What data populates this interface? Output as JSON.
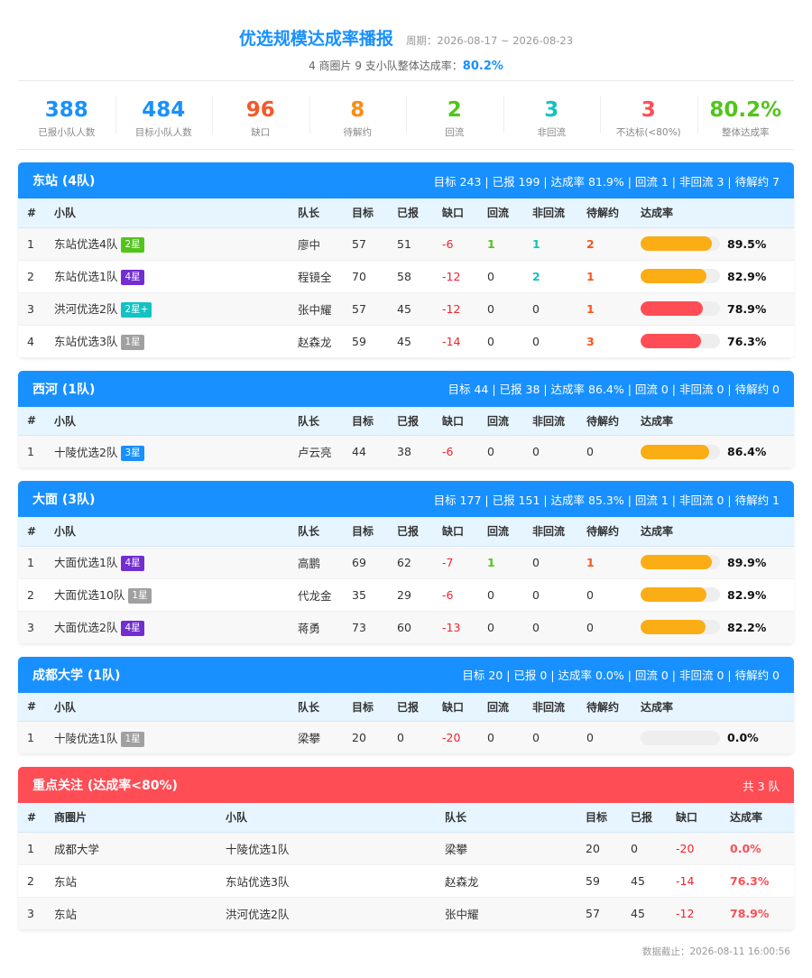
{
  "header": {
    "title": "优选规模达成率播报",
    "period": "周期：2026-08-17 ~ 2026-08-23",
    "subtitle_prefix": "4 商圈片 9 支小队整体达成率：",
    "overall_rate": "80.2%"
  },
  "stats": [
    {
      "value": "388",
      "label": "已报小队人数",
      "color": "#1890ff"
    },
    {
      "value": "484",
      "label": "目标小队人数",
      "color": "#1890ff"
    },
    {
      "value": "96",
      "label": "缺口",
      "color": "#f5582c"
    },
    {
      "value": "8",
      "label": "待解约",
      "color": "#fa8c16"
    },
    {
      "value": "2",
      "label": "回流",
      "color": "#52c41a"
    },
    {
      "value": "3",
      "label": "非回流",
      "color": "#13c2c2"
    },
    {
      "value": "3",
      "label": "不达标(<80%)",
      "color": "#ff4d55"
    },
    {
      "value": "80.2%",
      "label": "整体达成率",
      "color": "#52c41a"
    }
  ],
  "columns": [
    "#",
    "小队",
    "队长",
    "目标",
    "已报",
    "缺口",
    "回流",
    "非回流",
    "待解约",
    "达成率"
  ],
  "colors": {
    "blue": "#1890ff",
    "red": "#ff4d55",
    "bar_orange": "#faad14",
    "bar_red": "#ff4d55"
  },
  "sections": [
    {
      "name": "东站 (4队)",
      "summary": "目标 243 | 已报 199 | 达成率 81.9% | 回流 1 | 非回流 3 | 待解约 7",
      "rows": [
        {
          "idx": "1",
          "team": "东站优选4队",
          "star": "2星",
          "star_color": "#52c41a",
          "leader": "廖中",
          "target": "57",
          "reported": "51",
          "gap": "-6",
          "back": "1",
          "nonback": "1",
          "pending": "2",
          "rate": "89.5%",
          "rate_value": 89.5
        },
        {
          "idx": "2",
          "team": "东站优选1队",
          "star": "4星",
          "star_color": "#722ed1",
          "leader": "程镜全",
          "target": "70",
          "reported": "58",
          "gap": "-12",
          "back": "0",
          "nonback": "2",
          "pending": "1",
          "rate": "82.9%",
          "rate_value": 82.9
        },
        {
          "idx": "3",
          "team": "洪河优选2队",
          "star": "2星+",
          "star_color": "#13c2c2",
          "leader": "张中耀",
          "target": "57",
          "reported": "45",
          "gap": "-12",
          "back": "0",
          "nonback": "0",
          "pending": "1",
          "rate": "78.9%",
          "rate_value": 78.9
        },
        {
          "idx": "4",
          "team": "东站优选3队",
          "star": "1星",
          "star_color": "#a0a0a0",
          "leader": "赵森龙",
          "target": "59",
          "reported": "45",
          "gap": "-14",
          "back": "0",
          "nonback": "0",
          "pending": "3",
          "rate": "76.3%",
          "rate_value": 76.3
        }
      ]
    },
    {
      "name": "西河 (1队)",
      "summary": "目标 44 | 已报 38 | 达成率 86.4% | 回流 0 | 非回流 0 | 待解约 0",
      "rows": [
        {
          "idx": "1",
          "team": "十陵优选2队",
          "star": "3星",
          "star_color": "#1890ff",
          "leader": "卢云亮",
          "target": "44",
          "reported": "38",
          "gap": "-6",
          "back": "0",
          "nonback": "0",
          "pending": "0",
          "rate": "86.4%",
          "rate_value": 86.4
        }
      ]
    },
    {
      "name": "大面 (3队)",
      "summary": "目标 177 | 已报 151 | 达成率 85.3% | 回流 1 | 非回流 0 | 待解约 1",
      "rows": [
        {
          "idx": "1",
          "team": "大面优选1队",
          "star": "4星",
          "star_color": "#722ed1",
          "leader": "高鹏",
          "target": "69",
          "reported": "62",
          "gap": "-7",
          "back": "1",
          "nonback": "0",
          "pending": "1",
          "rate": "89.9%",
          "rate_value": 89.9
        },
        {
          "idx": "2",
          "team": "大面优选10队",
          "star": "1星",
          "star_color": "#a0a0a0",
          "leader": "代龙金",
          "target": "35",
          "reported": "29",
          "gap": "-6",
          "back": "0",
          "nonback": "0",
          "pending": "0",
          "rate": "82.9%",
          "rate_value": 82.9
        },
        {
          "idx": "3",
          "team": "大面优选2队",
          "star": "4星",
          "star_color": "#722ed1",
          "leader": "蒋勇",
          "target": "73",
          "reported": "60",
          "gap": "-13",
          "back": "0",
          "nonback": "0",
          "pending": "0",
          "rate": "82.2%",
          "rate_value": 82.2
        }
      ]
    },
    {
      "name": "成都大学 (1队)",
      "summary": "目标 20 | 已报 0 | 达成率 0.0% | 回流 0 | 非回流 0 | 待解约 0",
      "rows": [
        {
          "idx": "1",
          "team": "十陵优选1队",
          "star": "1星",
          "star_color": "#a0a0a0",
          "leader": "梁攀",
          "target": "20",
          "reported": "0",
          "gap": "-20",
          "back": "0",
          "nonback": "0",
          "pending": "0",
          "rate": "0.0%",
          "rate_value": 0
        }
      ]
    }
  ],
  "focus": {
    "name": "重点关注 (达成率<80%)",
    "count": "共 3 队",
    "columns": [
      "#",
      "商圈片",
      "小队",
      "队长",
      "目标",
      "已报",
      "缺口",
      "达成率"
    ],
    "rows": [
      {
        "idx": "1",
        "area": "成都大学",
        "team": "十陵优选1队",
        "leader": "梁攀",
        "target": "20",
        "reported": "0",
        "gap": "-20",
        "rate": "0.0%"
      },
      {
        "idx": "2",
        "area": "东站",
        "team": "东站优选3队",
        "leader": "赵森龙",
        "target": "59",
        "reported": "45",
        "gap": "-14",
        "rate": "76.3%"
      },
      {
        "idx": "3",
        "area": "东站",
        "team": "洪河优选2队",
        "leader": "张中耀",
        "target": "57",
        "reported": "45",
        "gap": "-12",
        "rate": "78.9%"
      }
    ]
  },
  "footer": "数据截止：2026-08-11 16:00:56"
}
